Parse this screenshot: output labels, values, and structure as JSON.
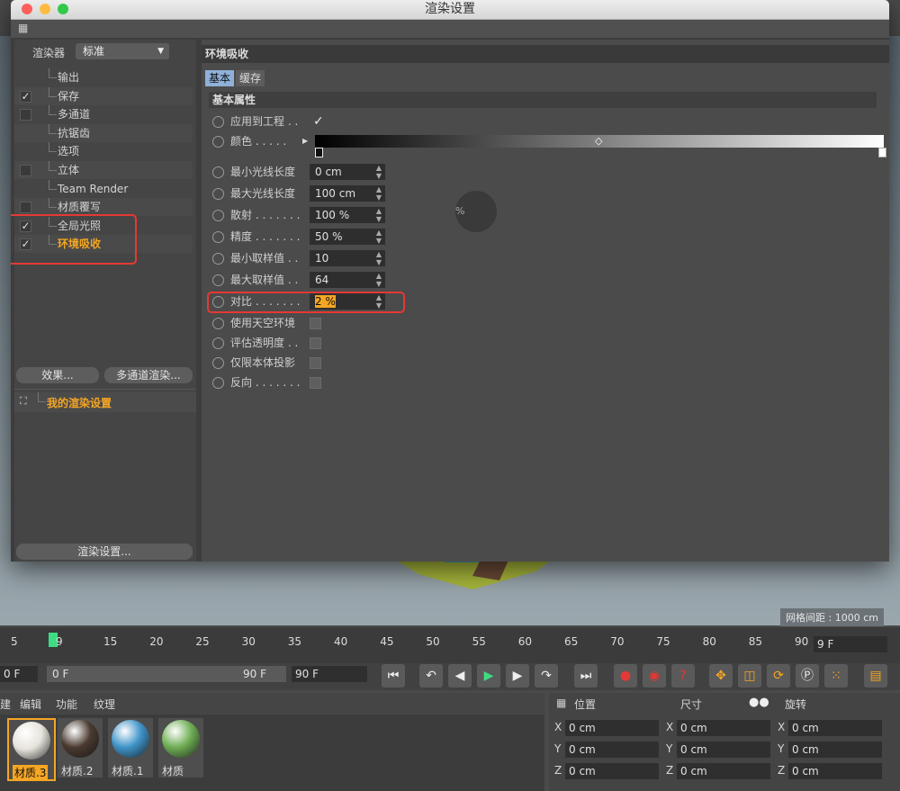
{
  "dialog": {
    "title": "渲染设置"
  },
  "renderer": {
    "label": "渲染器",
    "value": "标准"
  },
  "tree": [
    {
      "label": "输出",
      "checkbox": "none"
    },
    {
      "label": "保存",
      "checkbox": "checked"
    },
    {
      "label": "多通道",
      "checkbox": "unchecked"
    },
    {
      "label": "抗锯齿",
      "checkbox": "none"
    },
    {
      "label": "选项",
      "checkbox": "none"
    },
    {
      "label": "立体",
      "checkbox": "unchecked"
    },
    {
      "label": "Team Render",
      "checkbox": "none"
    },
    {
      "label": "材质覆写",
      "checkbox": "unchecked"
    },
    {
      "label": "全局光照",
      "checkbox": "checked"
    },
    {
      "label": "环境吸收",
      "checkbox": "checked"
    }
  ],
  "buttons": {
    "effects": "效果...",
    "multipass_render": "多通道渲染...",
    "render_settings": "渲染设置..."
  },
  "preset": {
    "label": "我的渲染设置"
  },
  "panel": {
    "title": "环境吸收",
    "tabs": [
      "基本",
      "缓存"
    ],
    "section": "基本属性",
    "apply_to_project": {
      "label": "应用到工程 . ."
    },
    "color": {
      "label": "颜色 . . . . . "
    },
    "fields": [
      {
        "label": "最小光线长度",
        "value": "0 cm"
      },
      {
        "label": "最大光线长度",
        "value": "100 cm"
      },
      {
        "label": "散射 . . . . . . .",
        "value": "100 %"
      },
      {
        "label": "精度 . . . . . . .",
        "value": "50 %"
      },
      {
        "label": "最小取样值 . .",
        "value": "10"
      },
      {
        "label": "最大取样值 . .",
        "value": "64"
      },
      {
        "label": "对比 . . . . . . .",
        "value": "2 %"
      }
    ],
    "checks": [
      {
        "label": "使用天空环境"
      },
      {
        "label": "评估透明度 . ."
      },
      {
        "label": "仅限本体投影"
      },
      {
        "label": "反向 . . . . . . ."
      }
    ],
    "ghost_value": "%"
  },
  "viewport": {
    "grid_label": "网格间距 : 1000 cm"
  },
  "timeline": {
    "ticks": [
      "5",
      "9",
      "15",
      "20",
      "25",
      "30",
      "35",
      "40",
      "45",
      "50",
      "55",
      "60",
      "65",
      "70",
      "75",
      "80",
      "85",
      "90"
    ],
    "current_frame": "9 F",
    "range_start": "0 F",
    "range_end": "90 F",
    "end_field": "90 F",
    "start_field": "0 F"
  },
  "material_menu": [
    "建",
    "编辑",
    "功能",
    "纹理"
  ],
  "materials": [
    {
      "label": "材质.3",
      "color": "#e6e3dc"
    },
    {
      "label": "材质.2",
      "color": "#4a3a30"
    },
    {
      "label": "材质.1",
      "color": "#3f93c8"
    },
    {
      "label": "材质",
      "color": "#6fae55"
    }
  ],
  "coords": {
    "headers": {
      "position": "位置",
      "size": "尺寸",
      "rotation": "旋转"
    },
    "axes": [
      "X",
      "Y",
      "Z"
    ],
    "value": "0 cm"
  },
  "colors": {
    "accent_orange": "#f5a623",
    "highlight_red": "#e53935",
    "play_green": "#3ddc84"
  }
}
